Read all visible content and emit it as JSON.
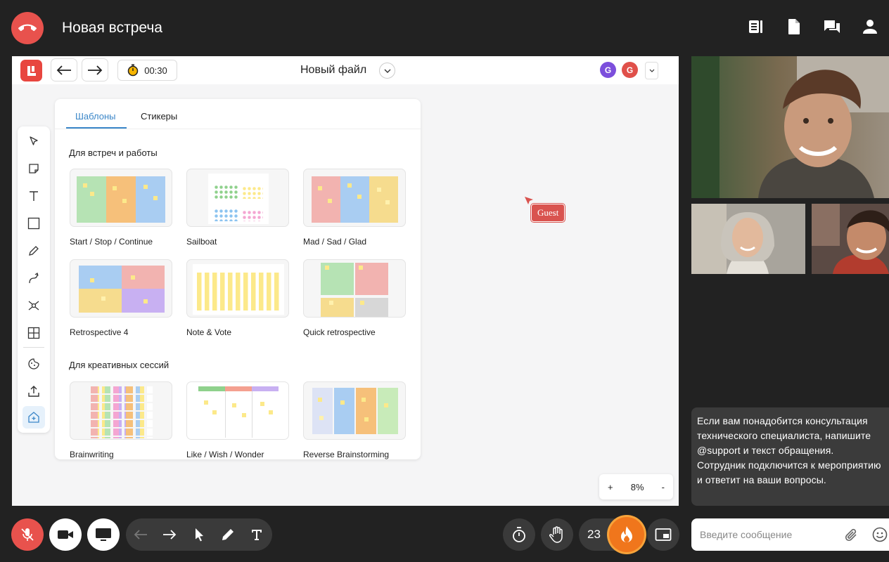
{
  "header": {
    "meeting_title": "Новая встреча"
  },
  "board": {
    "file_name": "Новый файл",
    "timer": "00:30",
    "avatars": [
      {
        "letter": "G",
        "color": "#7c4fdc"
      },
      {
        "letter": "G",
        "color": "#e0504a"
      }
    ],
    "zoom": {
      "minus": "-",
      "plus": "+",
      "value": "8%"
    },
    "guest_cursor": {
      "name": "Guest",
      "color": "#d9534f"
    }
  },
  "templates_panel": {
    "tabs": [
      {
        "label": "Шаблоны",
        "active": true
      },
      {
        "label": "Стикеры",
        "active": false
      }
    ],
    "sections": [
      {
        "title": "Для встреч и работы",
        "items": [
          {
            "label": "Start / Stop / Continue"
          },
          {
            "label": "Sailboat"
          },
          {
            "label": "Mad / Sad / Glad"
          },
          {
            "label": "Retrospective 4"
          },
          {
            "label": "Note & Vote"
          },
          {
            "label": "Quick retrospective"
          }
        ]
      },
      {
        "title": "Для креативных сессий",
        "items": [
          {
            "label": "Brainwriting"
          },
          {
            "label": "Like / Wish / Wonder"
          },
          {
            "label": "Reverse Brainstorming"
          }
        ]
      }
    ]
  },
  "chat": {
    "message": "Если вам понадобится консультация технического специалиста, напишите @support и текст обращения. Сотрудник подключится к мероприятию и ответит на ваши вопросы.",
    "input_placeholder": "Введите сообщение"
  },
  "controls": {
    "reaction_count": "23"
  },
  "colors": {
    "accent_red": "#e8524d",
    "tab_blue": "#3a86c8",
    "fire_orange": "#f0761c"
  }
}
